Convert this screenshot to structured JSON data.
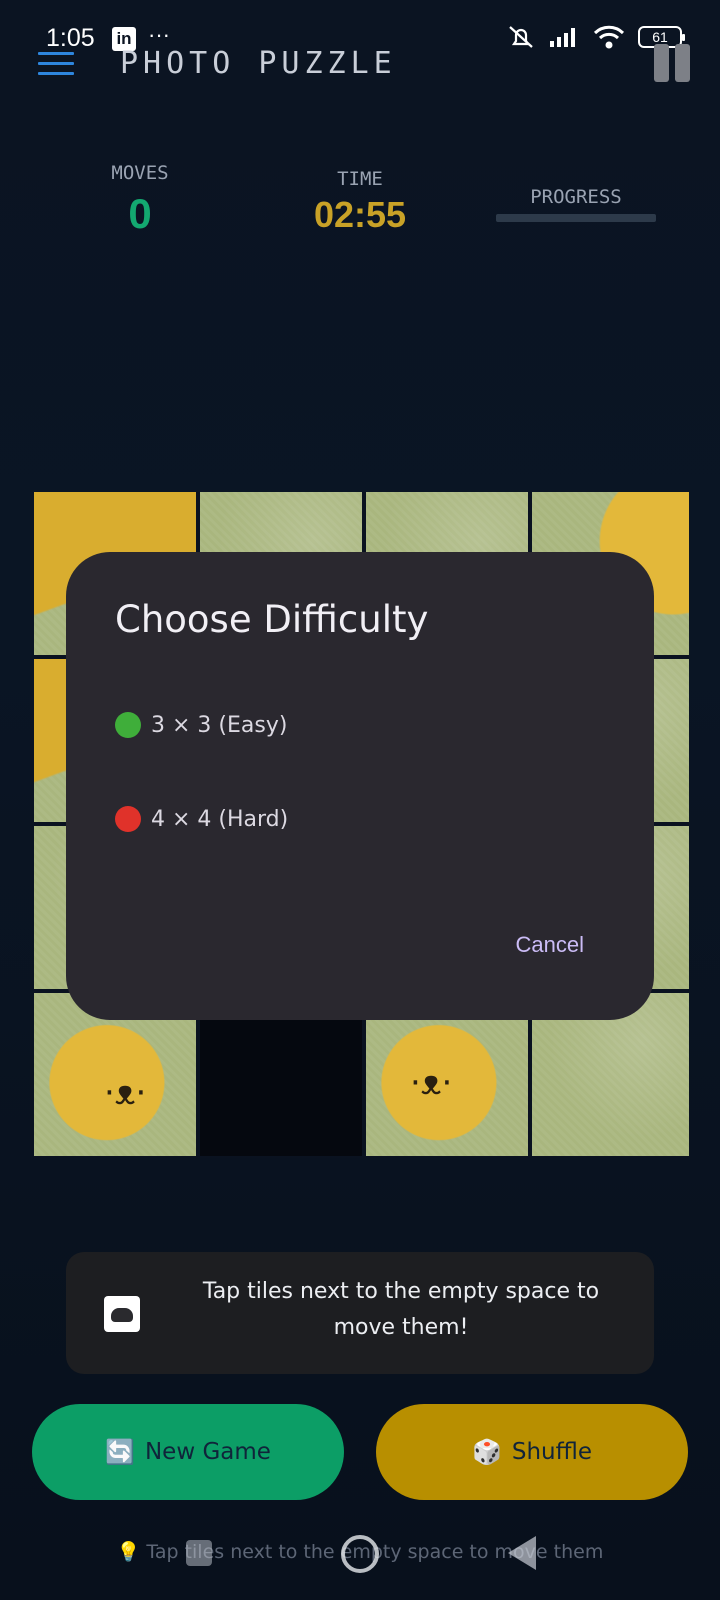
{
  "status_bar": {
    "time": "1:05",
    "notification_app": "in",
    "more": "···",
    "battery": "61"
  },
  "app_bar": {
    "title": "PHOTO PUZZLE"
  },
  "stats": {
    "moves_label": "MOVES",
    "moves_value": "0",
    "time_label": "TIME",
    "time_value": "02:55",
    "progress_label": "PROGRESS",
    "progress_fraction": 0
  },
  "dialog": {
    "title": "Choose Difficulty",
    "options": [
      {
        "label": "3 × 3  (Easy)",
        "color": "#3fae3a"
      },
      {
        "label": "4 × 4  (Hard)",
        "color": "#e0322a"
      }
    ],
    "cancel_label": "Cancel"
  },
  "hint_card": {
    "text": "Tap tiles next to the empty space to move them!"
  },
  "buttons": {
    "new_game_emoji": "🔄",
    "new_game_label": "New Game",
    "shuffle_emoji": "🎲",
    "shuffle_label": "Shuffle"
  },
  "footer_hint": "💡 Tap tiles next to the empty space to move them",
  "colors": {
    "moves": "#13a870",
    "time": "#c9a227",
    "new_game": "#0c9e66",
    "shuffle": "#b88f00",
    "dialog_bg": "#2a282f"
  }
}
